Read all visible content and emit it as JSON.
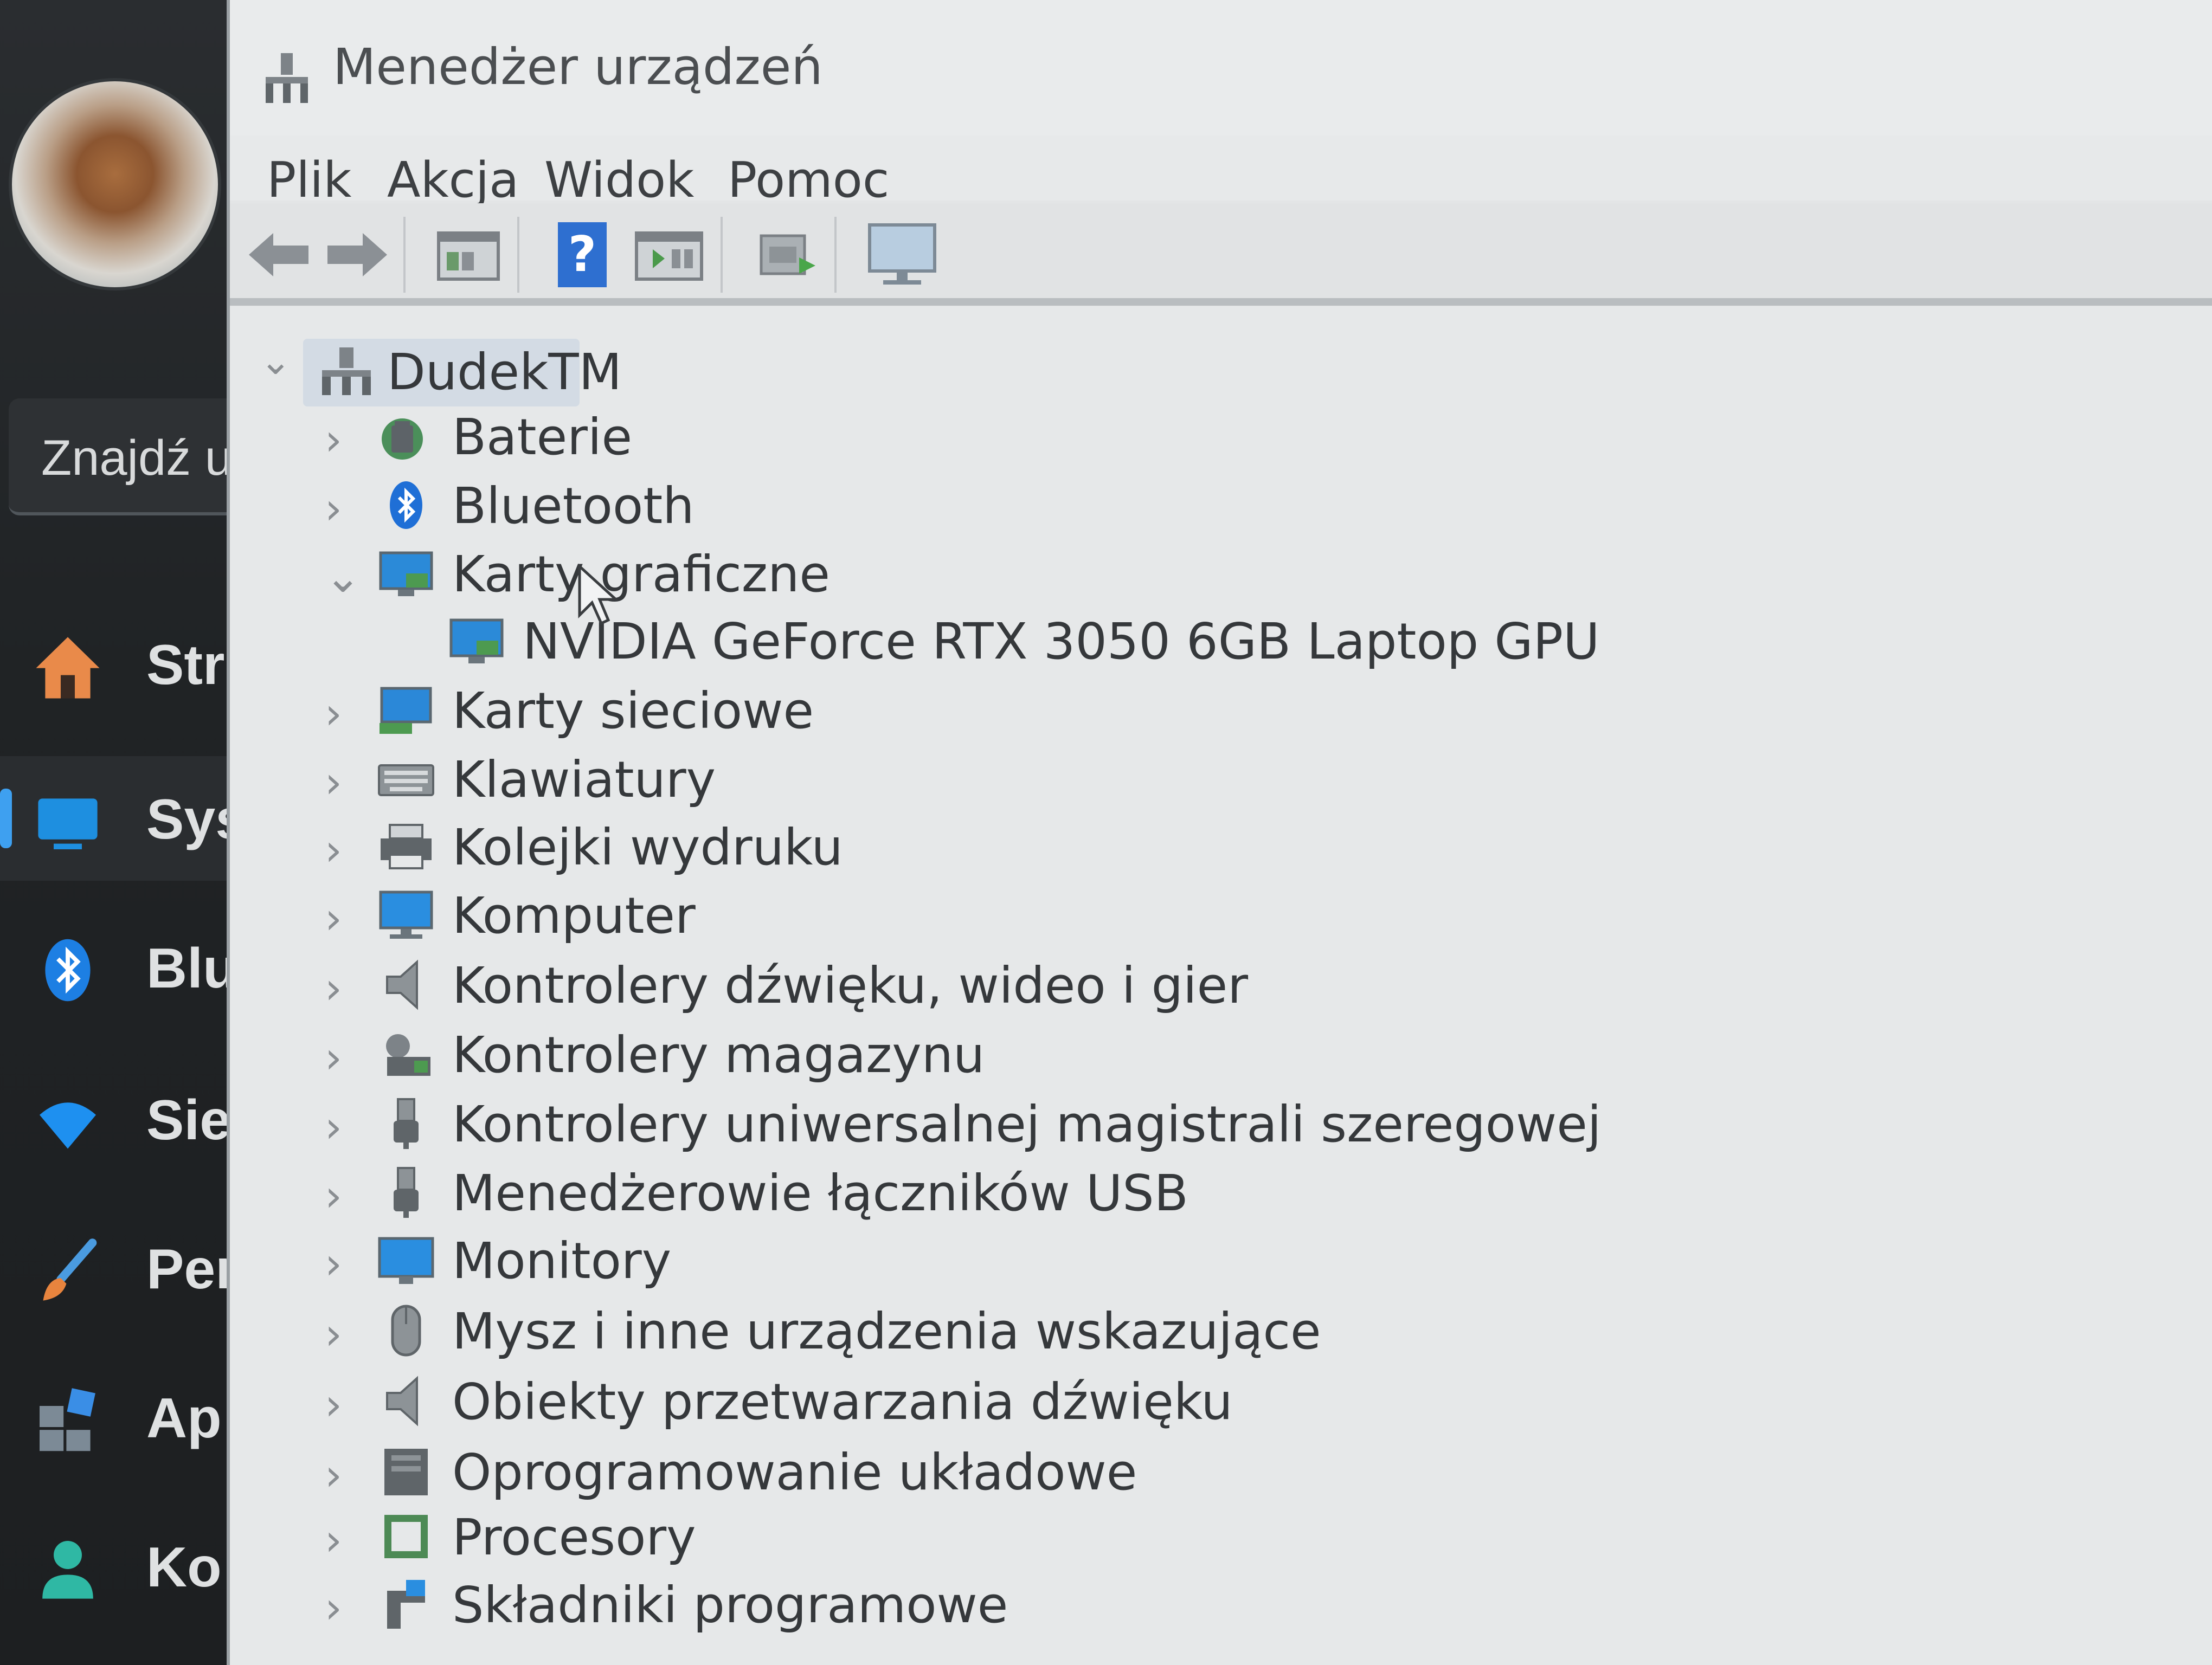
{
  "sidebar": {
    "search_text": "Znajdź u",
    "items": [
      {
        "label": "Str",
        "icon": "home-icon"
      },
      {
        "label": "Sys",
        "icon": "system-icon",
        "active": true
      },
      {
        "label": "Blu",
        "icon": "bluetooth-icon"
      },
      {
        "label": "Sie",
        "icon": "wifi-icon"
      },
      {
        "label": "Per",
        "icon": "brush-icon"
      },
      {
        "label": "Ap",
        "icon": "apps-icon"
      },
      {
        "label": "Ko",
        "icon": "person-icon"
      }
    ]
  },
  "window": {
    "title": "Menedżer urządzeń",
    "menu": [
      "Plik",
      "Akcja",
      "Widok",
      "Pomoc"
    ],
    "toolbar": [
      "back-arrow-icon",
      "forward-arrow-icon",
      "properties-icon",
      "help-icon",
      "update-driver-icon",
      "scan-hardware-icon",
      "monitor-icon"
    ]
  },
  "tree": {
    "root": "DudekTM",
    "nodes": [
      {
        "label": "Baterie",
        "icon": "battery-icon",
        "expanded": false
      },
      {
        "label": "Bluetooth",
        "icon": "bluetooth-icon",
        "expanded": false
      },
      {
        "label": "Karty graficzne",
        "icon": "display-adapter-icon",
        "expanded": true
      },
      {
        "label": "NVIDIA GeForce RTX 3050 6GB Laptop GPU",
        "icon": "display-adapter-icon",
        "child": true
      },
      {
        "label": "Karty sieciowe",
        "icon": "network-adapter-icon",
        "expanded": false
      },
      {
        "label": "Klawiatury",
        "icon": "keyboard-icon",
        "expanded": false
      },
      {
        "label": "Kolejki wydruku",
        "icon": "printer-icon",
        "expanded": false
      },
      {
        "label": "Komputer",
        "icon": "computer-icon",
        "expanded": false
      },
      {
        "label": "Kontrolery dźwięku, wideo i gier",
        "icon": "speaker-icon",
        "expanded": false
      },
      {
        "label": "Kontrolery magazynu",
        "icon": "storage-icon",
        "expanded": false
      },
      {
        "label": "Kontrolery uniwersalnej magistrali szeregowej",
        "icon": "usb-icon",
        "expanded": false
      },
      {
        "label": "Menedżerowie łączników USB",
        "icon": "usb-icon",
        "expanded": false
      },
      {
        "label": "Monitory",
        "icon": "monitor-icon",
        "expanded": false
      },
      {
        "label": "Mysz i inne urządzenia wskazujące",
        "icon": "mouse-icon",
        "expanded": false
      },
      {
        "label": "Obiekty przetwarzania dźwięku",
        "icon": "speaker-icon",
        "expanded": false
      },
      {
        "label": "Oprogramowanie układowe",
        "icon": "firmware-icon",
        "expanded": false
      },
      {
        "label": "Procesory",
        "icon": "processor-icon",
        "expanded": false
      },
      {
        "label": "Składniki programowe",
        "icon": "software-component-icon",
        "expanded": false
      }
    ]
  }
}
